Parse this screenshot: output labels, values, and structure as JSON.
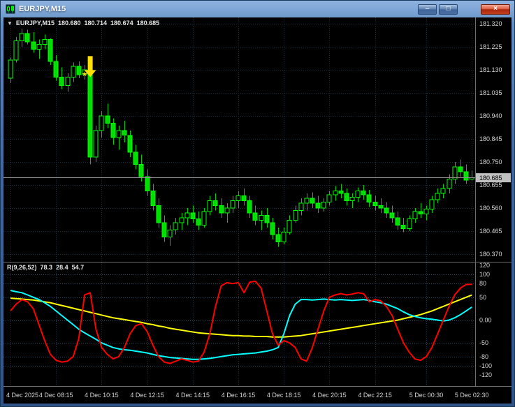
{
  "window": {
    "title": "EURJPY,M15",
    "controls": {
      "minimize": "–",
      "restore": "□",
      "close": "×"
    }
  },
  "chart_header": {
    "symbol": "EURJPY,M15",
    "open": "180.680",
    "high": "180.714",
    "low": "180.674",
    "close": "180.685"
  },
  "indicator_header": {
    "name": "R(9,26,52)",
    "values": [
      "78.3",
      "28.4",
      "54.7"
    ]
  },
  "price_axis": {
    "ticks": [
      "181.320",
      "181.225",
      "181.130",
      "181.035",
      "180.940",
      "180.845",
      "180.750",
      "180.655",
      "180.560",
      "180.465",
      "180.370"
    ],
    "current_price": "180.685",
    "current_price_value": 180.685
  },
  "indicator_axis": {
    "ticks": [
      {
        "value": 120,
        "label": "120"
      },
      {
        "value": 100,
        "label": "100"
      },
      {
        "value": 80,
        "label": "80"
      },
      {
        "value": 50,
        "label": "50"
      },
      {
        "value": 0,
        "label": "0.00"
      },
      {
        "value": -50,
        "label": "-50"
      },
      {
        "value": -80,
        "label": "-80"
      },
      {
        "value": -100,
        "label": "-100"
      },
      {
        "value": -120,
        "label": "-120"
      }
    ]
  },
  "time_axis": {
    "ticks": [
      {
        "index": 0,
        "label": "4 Dec 2025"
      },
      {
        "index": 8,
        "label": "4 Dec 08:15"
      },
      {
        "index": 16,
        "label": "4 Dec 10:15"
      },
      {
        "index": 24,
        "label": "4 Dec 12:15"
      },
      {
        "index": 32,
        "label": "4 Dec 14:15"
      },
      {
        "index": 40,
        "label": "4 Dec 16:15"
      },
      {
        "index": 48,
        "label": "4 Dec 18:15"
      },
      {
        "index": 56,
        "label": "4 Dec 20:15"
      },
      {
        "index": 64,
        "label": "4 Dec 22:15"
      },
      {
        "index": 73,
        "label": "5 Dec 00:30"
      },
      {
        "index": 81,
        "label": "5 Dec 02:30"
      }
    ]
  },
  "annotations": [
    {
      "type": "arrow-down-icon",
      "color": "#FFE100",
      "candle_index": 14,
      "price": 181.1
    },
    {
      "type": "star-icon",
      "glyph": "★",
      "color": "#FFE100",
      "candle_index": 13,
      "price": 181.115
    }
  ],
  "colors": {
    "background": "#000000",
    "grid": "#1B3044",
    "level": "#2E4E6E",
    "bull_candle": "#000000",
    "bear_candle": "#00DD00",
    "candle_outline": "#00FF00",
    "wick": "#00CC00",
    "price_line": "#909090",
    "axis_line": "#6E6E6E",
    "axis_text": "#D6D6D6",
    "price_tag_bg": "#C0C0C0",
    "red_line": "#FF0000",
    "cyan_line": "#00FFFF",
    "yellow_line": "#FFFF00"
  },
  "chart_data": [
    {
      "type": "candlestick",
      "symbol": "EURJPY",
      "timeframe": "M15",
      "ylim": [
        180.37,
        181.32
      ],
      "yticks": [
        181.32,
        181.225,
        181.13,
        181.035,
        180.94,
        180.845,
        180.75,
        180.655,
        180.56,
        180.465,
        180.37
      ],
      "ohlc": [
        [
          181.095,
          181.18,
          181.075,
          181.17
        ],
        [
          181.17,
          181.265,
          181.16,
          181.25
        ],
        [
          181.25,
          181.3,
          181.225,
          181.28
        ],
        [
          181.28,
          181.295,
          181.235,
          181.245
        ],
        [
          181.245,
          181.285,
          181.2,
          181.215
        ],
        [
          181.215,
          181.255,
          181.175,
          181.235
        ],
        [
          181.235,
          181.275,
          181.215,
          181.255
        ],
        [
          181.255,
          181.26,
          181.15,
          181.165
        ],
        [
          181.165,
          181.19,
          181.085,
          181.1
        ],
        [
          181.1,
          181.14,
          181.05,
          181.065
        ],
        [
          181.065,
          181.115,
          181.04,
          181.1
        ],
        [
          181.1,
          181.16,
          181.08,
          181.145
        ],
        [
          181.145,
          181.165,
          181.095,
          181.11
        ],
        [
          181.11,
          181.15,
          181.09,
          181.13
        ],
        [
          181.13,
          181.14,
          180.74,
          180.77
        ],
        [
          180.77,
          180.9,
          180.75,
          180.88
        ],
        [
          180.88,
          180.96,
          180.85,
          180.94
        ],
        [
          180.94,
          180.99,
          180.89,
          180.91
        ],
        [
          180.91,
          180.93,
          180.82,
          180.85
        ],
        [
          180.85,
          180.9,
          180.8,
          180.88
        ],
        [
          180.88,
          180.92,
          180.83,
          180.86
        ],
        [
          180.86,
          180.88,
          180.77,
          180.79
        ],
        [
          180.79,
          180.82,
          180.72,
          180.74
        ],
        [
          180.74,
          180.78,
          180.67,
          180.69
        ],
        [
          180.69,
          180.72,
          180.61,
          180.63
        ],
        [
          180.63,
          180.66,
          180.55,
          180.57
        ],
        [
          180.57,
          180.6,
          180.48,
          180.5
        ],
        [
          180.5,
          180.53,
          180.42,
          180.44
        ],
        [
          180.44,
          180.49,
          180.405,
          180.47
        ],
        [
          180.47,
          180.52,
          180.45,
          180.5
        ],
        [
          180.5,
          180.54,
          180.47,
          180.52
        ],
        [
          180.52,
          180.56,
          180.49,
          180.54
        ],
        [
          180.54,
          180.57,
          180.5,
          180.515
        ],
        [
          180.515,
          180.545,
          180.47,
          180.49
        ],
        [
          180.49,
          180.56,
          180.48,
          180.545
        ],
        [
          180.545,
          180.61,
          180.53,
          180.59
        ],
        [
          180.59,
          180.62,
          180.55,
          180.57
        ],
        [
          180.57,
          180.6,
          180.52,
          180.54
        ],
        [
          180.54,
          180.58,
          180.5,
          180.56
        ],
        [
          180.56,
          180.61,
          180.54,
          180.59
        ],
        [
          180.59,
          180.63,
          180.56,
          180.61
        ],
        [
          180.61,
          180.64,
          180.57,
          180.59
        ],
        [
          180.59,
          180.61,
          180.52,
          180.54
        ],
        [
          180.54,
          180.57,
          180.49,
          180.51
        ],
        [
          180.51,
          180.55,
          180.47,
          180.53
        ],
        [
          180.53,
          180.56,
          180.48,
          180.5
        ],
        [
          180.5,
          180.52,
          180.43,
          180.45
        ],
        [
          180.45,
          180.48,
          180.4,
          180.42
        ],
        [
          180.42,
          180.48,
          180.41,
          180.46
        ],
        [
          180.46,
          180.53,
          180.45,
          180.51
        ],
        [
          180.51,
          180.57,
          180.5,
          180.55
        ],
        [
          180.55,
          180.6,
          180.53,
          180.58
        ],
        [
          180.58,
          180.62,
          180.55,
          180.6
        ],
        [
          180.6,
          180.625,
          180.56,
          180.58
        ],
        [
          180.58,
          180.61,
          180.54,
          180.56
        ],
        [
          180.56,
          180.6,
          180.545,
          180.585
        ],
        [
          180.585,
          180.63,
          180.57,
          180.615
        ],
        [
          180.615,
          180.65,
          180.59,
          180.63
        ],
        [
          180.63,
          180.66,
          180.6,
          180.62
        ],
        [
          180.62,
          180.64,
          180.57,
          180.59
        ],
        [
          180.59,
          180.62,
          180.56,
          180.605
        ],
        [
          180.605,
          180.645,
          180.585,
          180.63
        ],
        [
          180.63,
          180.655,
          180.595,
          180.615
        ],
        [
          180.615,
          180.635,
          180.565,
          180.585
        ],
        [
          180.585,
          180.61,
          180.55,
          180.57
        ],
        [
          180.57,
          180.6,
          180.54,
          180.56
        ],
        [
          180.56,
          180.585,
          180.52,
          180.54
        ],
        [
          180.54,
          180.57,
          180.5,
          180.52
        ],
        [
          180.52,
          180.545,
          180.47,
          180.49
        ],
        [
          180.49,
          180.52,
          180.46,
          180.475
        ],
        [
          180.475,
          180.53,
          180.465,
          180.515
        ],
        [
          180.515,
          180.56,
          180.5,
          180.545
        ],
        [
          180.545,
          180.58,
          180.52,
          180.535
        ],
        [
          180.535,
          180.57,
          180.51,
          180.555
        ],
        [
          180.555,
          180.61,
          180.54,
          180.595
        ],
        [
          180.595,
          180.64,
          180.58,
          180.62
        ],
        [
          180.62,
          180.66,
          180.6,
          180.64
        ],
        [
          180.64,
          180.7,
          180.62,
          180.68
        ],
        [
          180.68,
          180.75,
          180.66,
          180.73
        ],
        [
          180.73,
          180.76,
          180.69,
          180.71
        ],
        [
          180.71,
          180.74,
          180.66,
          180.675
        ],
        [
          180.68,
          180.714,
          180.674,
          180.685
        ]
      ]
    },
    {
      "type": "line",
      "name": "R(9,26,52)",
      "ylim": [
        -120,
        120
      ],
      "legend_position": "none",
      "series": [
        {
          "name": "rci-fast",
          "color": "#FF0000",
          "values": [
            20,
            35,
            45,
            40,
            25,
            -10,
            -45,
            -75,
            -88,
            -92,
            -90,
            -80,
            -40,
            55,
            60,
            -20,
            -60,
            -75,
            -85,
            -80,
            -60,
            -30,
            -12,
            -8,
            -25,
            -55,
            -80,
            -92,
            -95,
            -90,
            -85,
            -88,
            -92,
            -90,
            -70,
            -30,
            30,
            75,
            82,
            80,
            82,
            60,
            83,
            85,
            70,
            20,
            -30,
            -55,
            -45,
            -50,
            -60,
            -85,
            -90,
            -60,
            -20,
            20,
            50,
            55,
            58,
            55,
            57,
            60,
            58,
            40,
            45,
            42,
            30,
            10,
            -20,
            -50,
            -70,
            -85,
            -88,
            -80,
            -60,
            -30,
            0,
            30,
            55,
            70,
            78,
            78.3
          ]
        },
        {
          "name": "rci-mid",
          "color": "#00FFFF",
          "values": [
            65,
            62,
            60,
            55,
            50,
            45,
            38,
            30,
            20,
            10,
            0,
            -10,
            -20,
            -28,
            -35,
            -42,
            -50,
            -55,
            -60,
            -63,
            -65,
            -66,
            -68,
            -70,
            -72,
            -75,
            -78,
            -80,
            -82,
            -83,
            -84,
            -85,
            -86,
            -86,
            -85,
            -84,
            -82,
            -80,
            -78,
            -76,
            -75,
            -74,
            -73,
            -72,
            -70,
            -68,
            -65,
            -60,
            -30,
            10,
            35,
            45,
            45,
            44,
            45,
            46,
            45,
            44,
            45,
            44,
            43,
            44,
            45,
            43,
            40,
            38,
            35,
            30,
            25,
            18,
            12,
            8,
            5,
            3,
            2,
            0,
            -2,
            0,
            5,
            12,
            20,
            28.4
          ]
        },
        {
          "name": "rci-slow",
          "color": "#FFFF00",
          "values": [
            48,
            47,
            46,
            45,
            44,
            42,
            40,
            38,
            35,
            32,
            29,
            26,
            23,
            20,
            17,
            14,
            11,
            8,
            5,
            3,
            1,
            -1,
            -3,
            -5,
            -8,
            -10,
            -13,
            -15,
            -18,
            -20,
            -22,
            -24,
            -26,
            -28,
            -29,
            -30,
            -31,
            -32,
            -33,
            -34,
            -34,
            -35,
            -35,
            -36,
            -36,
            -36,
            -37,
            -37,
            -37,
            -36,
            -35,
            -34,
            -32,
            -30,
            -28,
            -26,
            -24,
            -22,
            -20,
            -18,
            -16,
            -14,
            -12,
            -10,
            -8,
            -6,
            -4,
            -2,
            0,
            3,
            6,
            9,
            12,
            16,
            20,
            25,
            30,
            35,
            40,
            45,
            50,
            54.7
          ]
        }
      ]
    }
  ]
}
